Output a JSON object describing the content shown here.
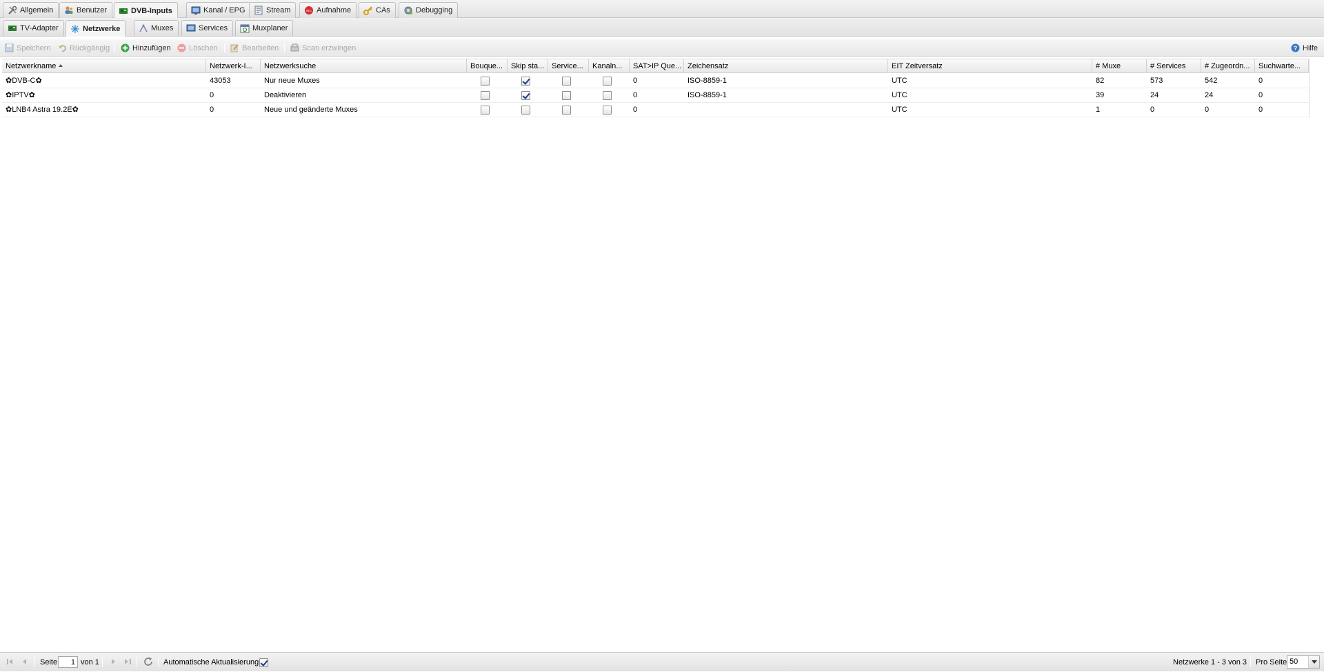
{
  "main_tabs": [
    {
      "label": "Allgemein",
      "icon": "wrench-icon"
    },
    {
      "label": "Benutzer",
      "icon": "users-icon"
    },
    {
      "label": "DVB-Inputs",
      "icon": "dvb-card-icon",
      "active": true
    },
    {
      "label": "Kanal / EPG",
      "icon": "tv-icon"
    },
    {
      "label": "Stream",
      "icon": "stream-icon"
    },
    {
      "label": "Aufnahme",
      "icon": "record-icon"
    },
    {
      "label": "CAs",
      "icon": "key-icon"
    },
    {
      "label": "Debugging",
      "icon": "debug-gear-icon"
    }
  ],
  "sub_tabs": [
    {
      "label": "TV-Adapter",
      "icon": "adapter-icon"
    },
    {
      "label": "Netzwerke",
      "icon": "network-icon",
      "active": true
    },
    {
      "label": "Muxes",
      "icon": "mux-icon"
    },
    {
      "label": "Services",
      "icon": "services-icon"
    },
    {
      "label": "Muxplaner",
      "icon": "muxplanner-icon"
    }
  ],
  "toolbar": {
    "save": "Speichern",
    "undo": "Rückgängig",
    "add": "Hinzufügen",
    "delete": "Löschen",
    "edit": "Bearbeiten",
    "scan": "Scan erzwingen",
    "help": "Hilfe"
  },
  "grid": {
    "columns": [
      "Netzwerkname",
      "Netzwerk-I...",
      "Netzwerksuche",
      "Bouque...",
      "Skip sta...",
      "Service...",
      "Kanaln...",
      "SAT>IP Que...",
      "Zeichensatz",
      "EIT Zeitversatz",
      "# Muxe",
      "# Services",
      "# Zugeordn...",
      "Suchwarte..."
    ],
    "rows": [
      {
        "name": "✿DVB-C✿",
        "network_id": "43053",
        "discovery": "Nur neue Muxes",
        "bouquet": false,
        "skip_startup": true,
        "service_discovery": false,
        "channel_numbers": false,
        "satip_source": "0",
        "charset": "ISO-8859-1",
        "eit_offset": "UTC",
        "muxes": "82",
        "services": "573",
        "mapped": "542",
        "scan_queue": "0"
      },
      {
        "name": "✿IPTV✿",
        "network_id": "0",
        "discovery": "Deaktivieren",
        "bouquet": false,
        "skip_startup": true,
        "service_discovery": false,
        "channel_numbers": false,
        "satip_source": "0",
        "charset": "ISO-8859-1",
        "eit_offset": "UTC",
        "muxes": "39",
        "services": "24",
        "mapped": "24",
        "scan_queue": "0"
      },
      {
        "name": "✿LNB4 Astra 19.2E✿",
        "network_id": "0",
        "discovery": "Neue und geänderte Muxes",
        "bouquet": false,
        "skip_startup": false,
        "service_discovery": false,
        "channel_numbers": false,
        "satip_source": "0",
        "charset": "",
        "eit_offset": "UTC",
        "muxes": "1",
        "services": "0",
        "mapped": "0",
        "scan_queue": "0"
      }
    ]
  },
  "paging": {
    "page_label": "Seite",
    "page_value": "1",
    "of_label": "von 1",
    "auto_refresh_label": "Automatische Aktualisierung",
    "auto_refresh_checked": true,
    "summary": "Netzwerke 1 - 3 von 3",
    "per_page_label": "Pro Seite",
    "per_page_value": "50"
  }
}
